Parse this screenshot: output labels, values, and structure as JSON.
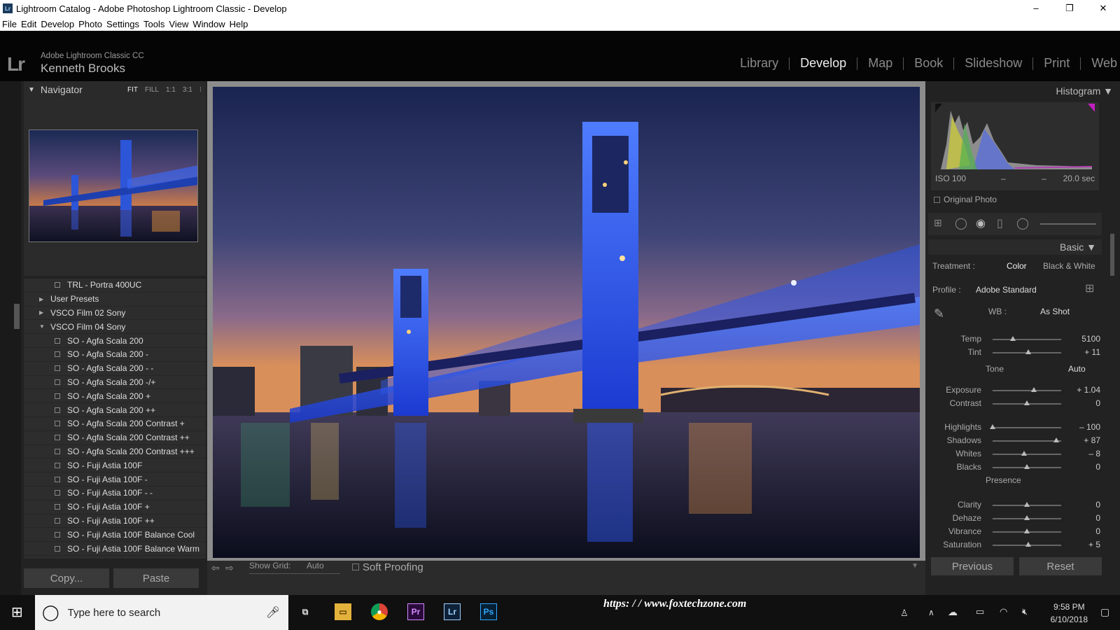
{
  "window": {
    "title": "Lightroom Catalog - Adobe Photoshop Lightroom Classic - Develop",
    "min": "–",
    "max": "❐",
    "close": "✕"
  },
  "menu": [
    "File",
    "Edit",
    "Develop",
    "Photo",
    "Settings",
    "Tools",
    "View",
    "Window",
    "Help"
  ],
  "identity": {
    "logo": "Lr",
    "product": "Adobe Lightroom Classic CC",
    "user": "Kenneth Brooks"
  },
  "modules": [
    "Library",
    "Develop",
    "Map",
    "Book",
    "Slideshow",
    "Print",
    "Web"
  ],
  "navigator": {
    "title": "Navigator",
    "zoom": [
      "FIT",
      "FILL",
      "1:1",
      "3:1"
    ]
  },
  "presets": [
    {
      "label": "TRL - Portra 400UC",
      "folder": false
    },
    {
      "label": "User Presets",
      "folder": true,
      "open": false
    },
    {
      "label": "VSCO Film 02 Sony",
      "folder": true,
      "open": false
    },
    {
      "label": "VSCO Film 04 Sony",
      "folder": true,
      "open": true
    },
    {
      "label": "SO - Agfa Scala 200",
      "folder": false
    },
    {
      "label": "SO - Agfa Scala 200 -",
      "folder": false
    },
    {
      "label": "SO - Agfa Scala 200 - -",
      "folder": false
    },
    {
      "label": "SO - Agfa Scala 200 -/+",
      "folder": false
    },
    {
      "label": "SO - Agfa Scala 200 +",
      "folder": false
    },
    {
      "label": "SO - Agfa Scala 200 ++",
      "folder": false
    },
    {
      "label": "SO - Agfa Scala 200 Contrast +",
      "folder": false
    },
    {
      "label": "SO - Agfa Scala 200 Contrast ++",
      "folder": false
    },
    {
      "label": "SO - Agfa Scala 200 Contrast +++",
      "folder": false
    },
    {
      "label": "SO - Fuji Astia 100F",
      "folder": false
    },
    {
      "label": "SO - Fuji Astia 100F -",
      "folder": false
    },
    {
      "label": "SO - Fuji Astia 100F - -",
      "folder": false
    },
    {
      "label": "SO - Fuji Astia 100F +",
      "folder": false
    },
    {
      "label": "SO - Fuji Astia 100F ++",
      "folder": false
    },
    {
      "label": "SO - Fuji Astia 100F Balance Cool",
      "folder": false
    },
    {
      "label": "SO - Fuji Astia 100F Balance Warm",
      "folder": false
    }
  ],
  "left_buttons": {
    "copy": "Copy...",
    "paste": "Paste"
  },
  "toolbar": {
    "show_grid": "Show Grid:",
    "grid_value": "Auto",
    "soft_proofing": "Soft Proofing"
  },
  "histogram": {
    "title": "Histogram",
    "iso": "ISO 100",
    "dash1": "–",
    "dash2": "–",
    "shutter": "20.0 sec",
    "original_photo": "Original Photo"
  },
  "basic": {
    "title": "Basic",
    "treatment_label": "Treatment :",
    "treatment_color": "Color",
    "treatment_bw": "Black & White",
    "profile_label": "Profile :",
    "profile_value": "Adobe Standard",
    "wb_label": "WB :",
    "wb_value": "As Shot",
    "tone_label": "Tone",
    "auto": "Auto",
    "presence_label": "Presence"
  },
  "sliders": [
    {
      "label": "Temp",
      "value": "5100",
      "pos": 0.3
    },
    {
      "label": "Tint",
      "value": "+ 11",
      "pos": 0.52
    },
    {
      "label": "Exposure",
      "value": "+ 1.04",
      "pos": 0.6
    },
    {
      "label": "Contrast",
      "value": "0",
      "pos": 0.5
    },
    {
      "label": "Highlights",
      "value": "– 100",
      "pos": 0.0
    },
    {
      "label": "Shadows",
      "value": "+ 87",
      "pos": 0.93
    },
    {
      "label": "Whites",
      "value": "– 8",
      "pos": 0.46
    },
    {
      "label": "Blacks",
      "value": "0",
      "pos": 0.5
    },
    {
      "label": "Clarity",
      "value": "0",
      "pos": 0.5
    },
    {
      "label": "Dehaze",
      "value": "0",
      "pos": 0.5
    },
    {
      "label": "Vibrance",
      "value": "0",
      "pos": 0.5
    },
    {
      "label": "Saturation",
      "value": "+ 5",
      "pos": 0.52
    }
  ],
  "right_buttons": {
    "previous": "Previous",
    "reset": "Reset"
  },
  "taskbar": {
    "search_placeholder": "Type here to search",
    "url": "https: / / www.foxtechzone.com",
    "time": "9:58 PM",
    "date": "6/10/2018",
    "premiere": "Pr",
    "lightroom": "Lr",
    "photoshop": "Ps"
  }
}
